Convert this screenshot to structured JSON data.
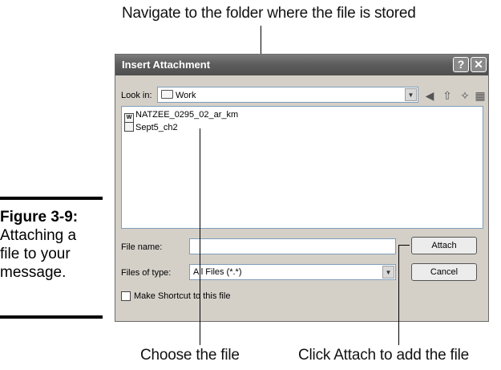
{
  "callouts": {
    "top": "Navigate to the folder where the file is stored",
    "bottom_left": "Choose the file",
    "bottom_right": "Click Attach to add the file"
  },
  "figure": {
    "number": "Figure 3-9:",
    "caption_lines": [
      "Attaching a",
      "file to your",
      "message."
    ]
  },
  "dialog": {
    "title": "Insert Attachment",
    "help_button": "?",
    "close_button": "✕",
    "look_in_label": "Look in:",
    "look_in_value": "Work",
    "files": [
      {
        "name": "NATZEE_0295_02_ar_km",
        "icon": "word-document-icon"
      },
      {
        "name": "Sept5_ch2",
        "icon": "document-icon"
      }
    ],
    "file_name_label": "File name:",
    "file_name_value": "",
    "files_of_type_label": "Files of type:",
    "files_of_type_value": "All Files (*.*)",
    "attach_button": "Attach",
    "cancel_button": "Cancel",
    "shortcut_checkbox_label": "Make Shortcut to this file",
    "shortcut_checked": false
  }
}
